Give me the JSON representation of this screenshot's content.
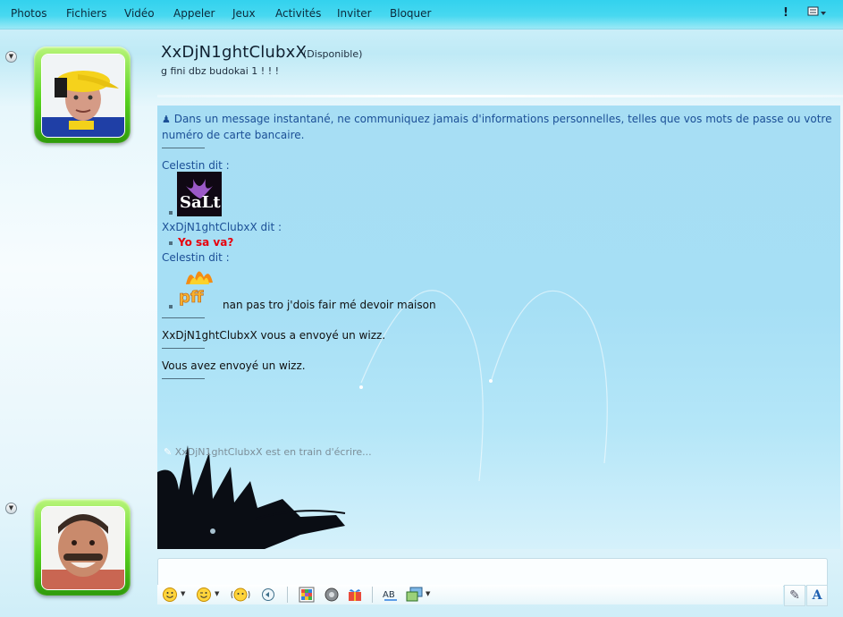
{
  "menu": {
    "items": [
      "Photos",
      "Fichiers",
      "Vidéo",
      "Appeler",
      "Jeux",
      "Activités",
      "Inviter",
      "Bloquer"
    ],
    "icons": [
      "alert-icon",
      "menu-options-icon"
    ]
  },
  "contact": {
    "name": "XxDjN1ghtClubxX",
    "status": "(Disponible)",
    "personal_message": "g fini dbz budokai 1 ! ! !"
  },
  "conversation": {
    "warning": "Dans un message instantané, ne communiquez jamais d'informations personnelles, telles que vos mots de passe ou votre",
    "warning_line2": "numéro de carte bancaire.",
    "msg1_sender": "Celestin dit :",
    "msg2_sender": "XxDjN1ghtClubxX dit :",
    "msg2_text": "Yo sa va?",
    "msg3_sender": "Celestin dit :",
    "msg3_text": "nan pas tro j'dois fair mé devoir maison",
    "wizz_received": "XxDjN1ghtClubxX vous a envoyé un wizz.",
    "wizz_sent": "Vous avez envoyé un wizz.",
    "typing": "XxDjN1ghtClubxX est en train d'écrire..."
  },
  "colors": {
    "menubar": "#47d8f0",
    "conversation_bg": "#a7def4",
    "sender": "#1b4f96",
    "bold_red": "#e8000c",
    "avatar_frame": "#57d21e"
  },
  "toolbar_icons": [
    "emoticon-icon",
    "wink-icon",
    "nudge-icon",
    "voice-clip-icon",
    "background-icon",
    "games-icon",
    "gift-icon",
    "spelling-icon",
    "image-icon",
    "handwriting-icon",
    "font-icon"
  ]
}
